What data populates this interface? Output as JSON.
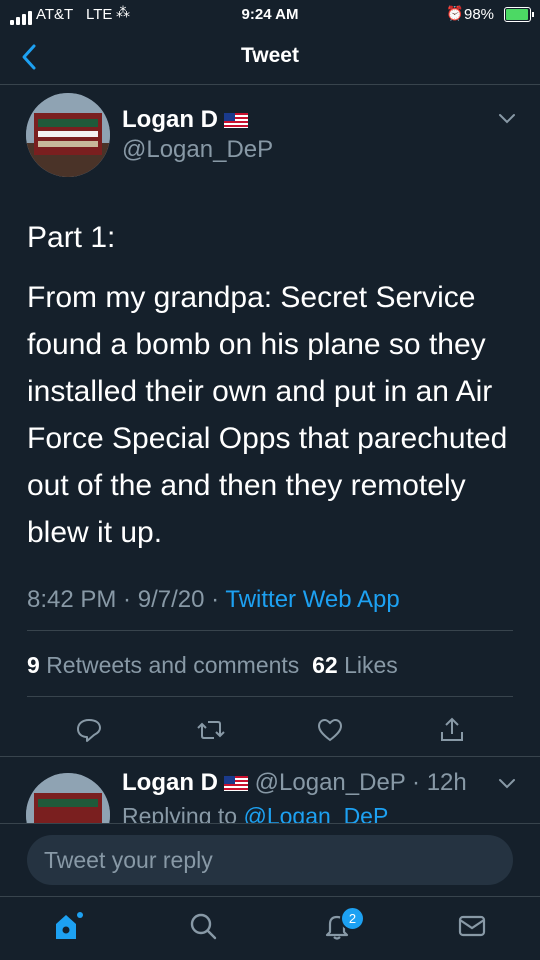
{
  "status_bar": {
    "carrier": "AT&T",
    "network": "LTE",
    "time": "9:24 AM",
    "battery": "98%"
  },
  "nav": {
    "title": "Tweet"
  },
  "tweet": {
    "author_name": "Logan D",
    "author_handle": "@Logan_DeP",
    "paragraph_1": "Part 1:",
    "paragraph_2": "From my grandpa: Secret Service found a bomb on his plane so they installed their own and put in an Air Force Special Opps that parechuted out of the and then they remotely blew it up.",
    "time": "8:42 PM",
    "date": "9/7/20",
    "source": "Twitter Web App",
    "retweet_count": "9",
    "retweet_label": "Retweets and comments",
    "like_count": "62",
    "like_label": "Likes"
  },
  "reply": {
    "author_name": "Logan D",
    "author_handle": "@Logan_DeP",
    "age": "12h",
    "replying_prefix": "Replying to",
    "replying_handle": "@Logan_DeP"
  },
  "compose": {
    "placeholder": "Tweet your reply"
  },
  "tabbar": {
    "notifications_badge": "2"
  },
  "colors": {
    "background": "#15202b",
    "accent": "#1da1f2",
    "muted": "#8899a6",
    "divider": "#38444d"
  }
}
